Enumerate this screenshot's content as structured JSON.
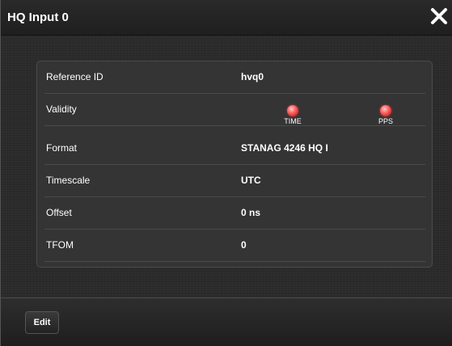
{
  "dialog": {
    "title": "HQ Input 0",
    "close_icon": "close-icon"
  },
  "fields": [
    {
      "label": "Reference ID",
      "value": "hvq0"
    },
    {
      "label": "Validity",
      "indicators": [
        {
          "label": "TIME",
          "status": "red",
          "color": "#e53935"
        },
        {
          "label": "PPS",
          "status": "red",
          "color": "#e53935"
        }
      ]
    },
    {
      "label": "Format",
      "value": "STANAG 4246 HQ I"
    },
    {
      "label": "Timescale",
      "value": "UTC"
    },
    {
      "label": "Offset",
      "value": "0 ns"
    },
    {
      "label": "TFOM",
      "value": "0"
    }
  ],
  "footer": {
    "edit_label": "Edit"
  }
}
